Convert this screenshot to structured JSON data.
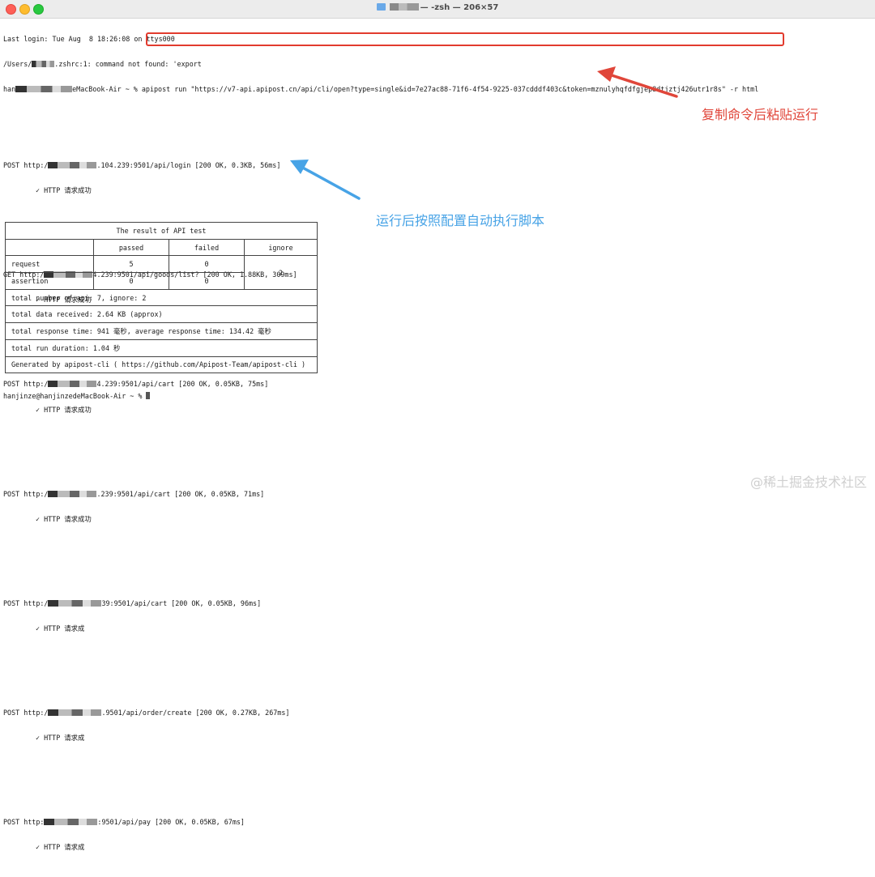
{
  "window": {
    "title": "— -zsh — 206×57"
  },
  "terminal": {
    "last_login": "Last login: Tue Aug  8 18:26:08 on ttys000",
    "rc_prefix": "/Users/",
    "rc_suffix": ".zshrc:1: command not found: 'export",
    "prompt_prefix": "han",
    "prompt_suffix": "eMacBook-Air ~ % ",
    "command": "apipost run \"https://v7-api.apipost.cn/api/cli/open?type=single&id=7e27ac88-71f6-4f54-9225-037cdddf403c&token=mznulyhqfdfgjep8dtjztj426utr1r8s\" -r html",
    "requests": [
      {
        "method_prefix": "POST http:/",
        "tail": ".104.239:9501/api/login [200 OK, 0.3KB, 56ms]",
        "status": "✓ HTTP 请求成功"
      },
      {
        "method_prefix": "GET http:/",
        "tail": "4.239:9501/api/goods/list? [200 OK, 1.88KB, 309ms]",
        "status": "✓ HTTP 请求成功"
      },
      {
        "method_prefix": "POST http:/",
        "tail": "4.239:9501/api/cart [200 OK, 0.05KB, 75ms]",
        "status": "✓ HTTP 请求成功"
      },
      {
        "method_prefix": "POST http:/",
        "tail": ".239:9501/api/cart [200 OK, 0.05KB, 71ms]",
        "status": "✓ HTTP 请求成功"
      },
      {
        "method_prefix": "POST http:/",
        "tail": "39:9501/api/cart [200 OK, 0.05KB, 96ms]",
        "status": "✓ HTTP 请求成"
      },
      {
        "method_prefix": "POST http:/",
        "tail": ".9501/api/order/create [200 OK, 0.27KB, 267ms]",
        "status": "✓ HTTP 请求成"
      },
      {
        "method_prefix": "POST http:",
        "tail": ":9501/api/pay [200 OK, 0.05KB, 67ms]",
        "status": "✓ HTTP 请求成"
      }
    ],
    "final_prompt": "hanjinze@hanjinzedeMacBook-Air ~ % "
  },
  "result_table": {
    "title": "The result of API test",
    "headers": [
      "passed",
      "failed",
      "ignore"
    ],
    "rows": [
      {
        "label": "request",
        "passed": "5",
        "failed": "0"
      },
      {
        "label": "assertion",
        "passed": "0",
        "failed": "0"
      }
    ],
    "ignore_value": "2",
    "summary": [
      "total number of api: 7, ignore: 2",
      "total data received: 2.64 KB (approx)",
      "total response time: 941 毫秒, average response time: 134.42 毫秒",
      "total run duration: 1.04 秒",
      "Generated by apipost-cli ( https://github.com/Apipost-Team/apipost-cli )"
    ]
  },
  "annotations": {
    "red_text": "复制命令后粘贴运行",
    "red_color": "#e0463a",
    "blue_text": "运行后按照配置自动执行脚本",
    "blue_color": "#47a3e6"
  },
  "watermark": "@稀土掘金技术社区"
}
